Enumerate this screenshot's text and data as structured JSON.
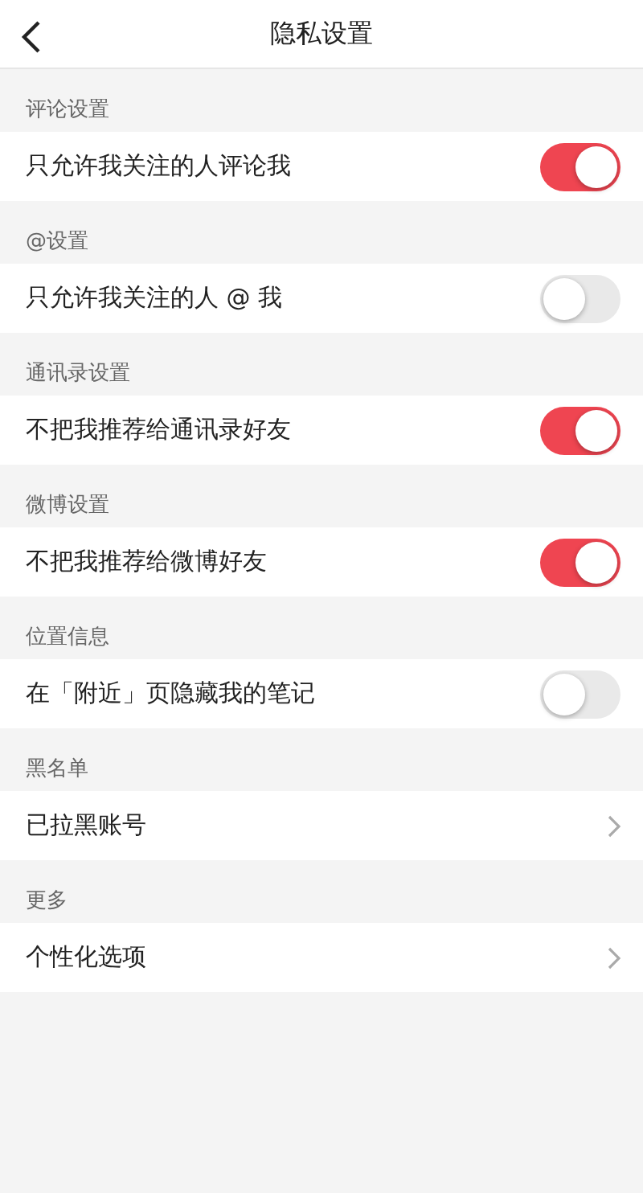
{
  "header": {
    "title": "隐私设置"
  },
  "sections": [
    {
      "title": "评论设置",
      "items": [
        {
          "kind": "toggle",
          "label": "只允许我关注的人评论我",
          "on": true
        }
      ]
    },
    {
      "title": "@设置",
      "items": [
        {
          "kind": "toggle",
          "label": "只允许我关注的人 @ 我",
          "on": false
        }
      ]
    },
    {
      "title": "通讯录设置",
      "items": [
        {
          "kind": "toggle",
          "label": "不把我推荐给通讯录好友",
          "on": true
        }
      ]
    },
    {
      "title": "微博设置",
      "items": [
        {
          "kind": "toggle",
          "label": "不把我推荐给微博好友",
          "on": true
        }
      ]
    },
    {
      "title": "位置信息",
      "items": [
        {
          "kind": "toggle",
          "label": "在「附近」页隐藏我的笔记",
          "on": false
        }
      ]
    },
    {
      "title": "黑名单",
      "items": [
        {
          "kind": "link",
          "label": "已拉黑账号"
        }
      ]
    },
    {
      "title": "更多",
      "items": [
        {
          "kind": "link",
          "label": "个性化选项"
        }
      ]
    }
  ]
}
